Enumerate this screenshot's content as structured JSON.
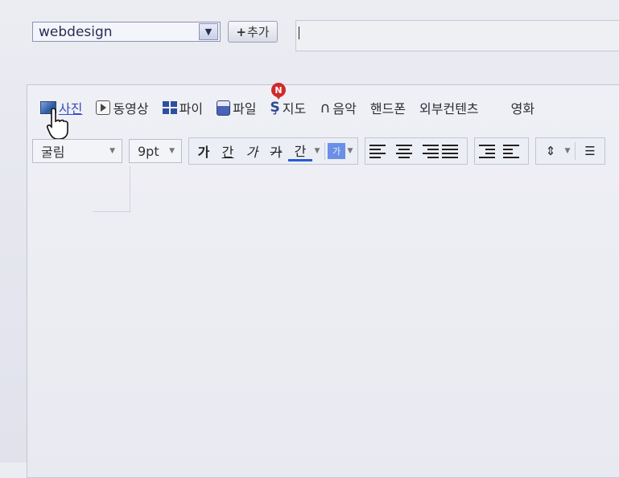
{
  "top": {
    "category_value": "webdesign",
    "add_label": "추가"
  },
  "insert_toolbar": {
    "items": [
      {
        "label": "사진",
        "icon": "photo-icon"
      },
      {
        "label": "동영상",
        "icon": "video-icon"
      },
      {
        "label": "파이",
        "icon": "grid-icon"
      },
      {
        "label": "파일",
        "icon": "file-icon"
      },
      {
        "label": "지도",
        "icon": "map-icon"
      },
      {
        "label": "음악",
        "icon": "headphones-icon"
      },
      {
        "label": "핸드폰"
      },
      {
        "label": "외부컨텐츠"
      },
      {
        "label": "영화"
      }
    ],
    "new_badge": "N"
  },
  "format_toolbar": {
    "font_family": "굴림",
    "font_size": "9pt",
    "bold": "가",
    "underline": "간",
    "italic": "가",
    "strike": "가",
    "color": "간",
    "bg_color": "가"
  },
  "colors": {
    "accent": "#2a5bd0",
    "badge": "#d02a2a",
    "link": "#3a4cc0"
  }
}
